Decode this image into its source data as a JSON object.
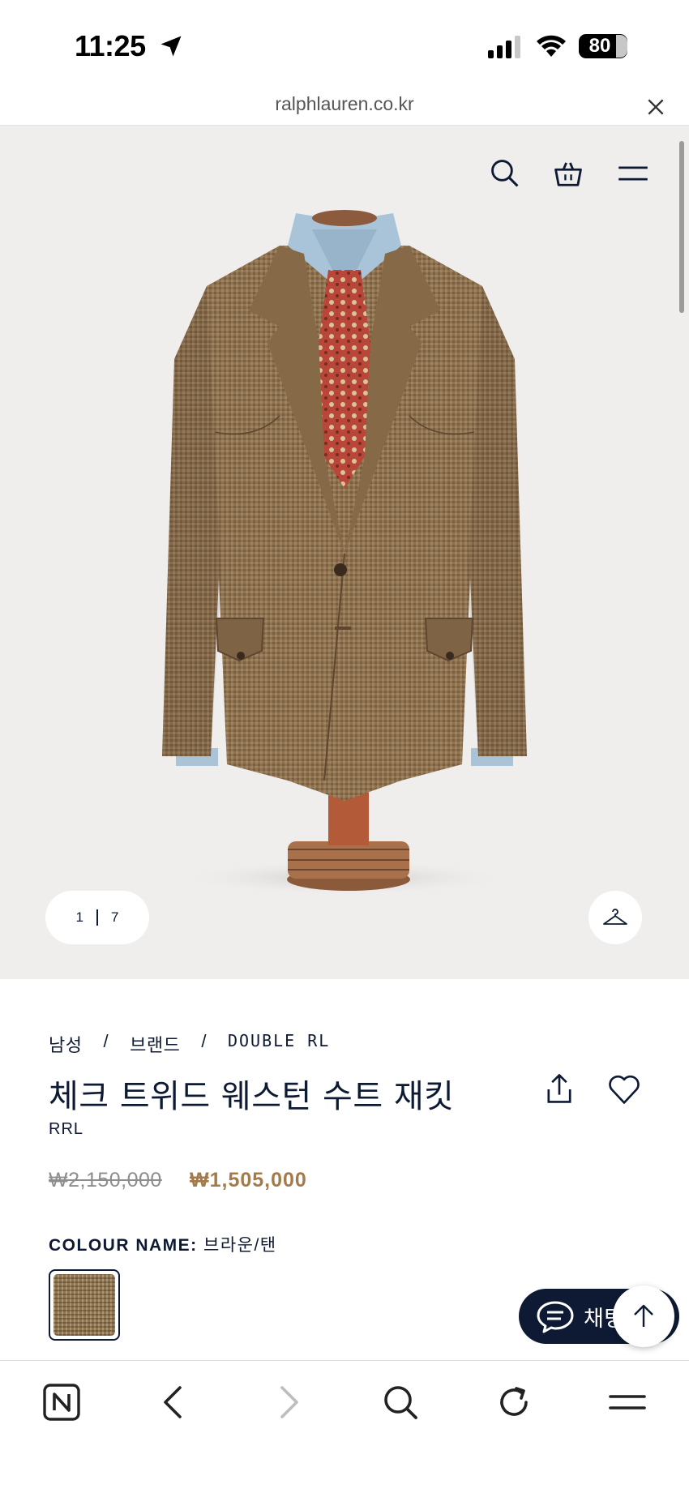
{
  "status_bar": {
    "time": "11:25",
    "battery": "80"
  },
  "browser": {
    "url": "ralphlauren.co.kr"
  },
  "hero": {
    "pager_current": "1",
    "pager_total": "7"
  },
  "breadcrumb": {
    "item1": "남성",
    "item2": "브랜드",
    "item3": "DOUBLE RL",
    "separator": "/"
  },
  "product": {
    "title": "체크 트위드 웨스턴 수트 재킷",
    "brand": "RRL",
    "price_original": "₩2,150,000",
    "price_sale": "₩1,505,000",
    "colour_label": "COLOUR NAME:",
    "colour_value": "브라운/탠"
  },
  "chat": {
    "label": "채팅 문의"
  },
  "colors": {
    "navy": "#0e1a33",
    "sale": "#a47a4a",
    "hero_bg": "#efeeed"
  }
}
